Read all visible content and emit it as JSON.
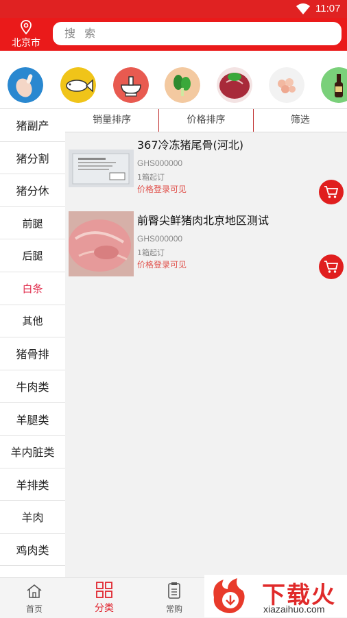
{
  "status_bar": {
    "time": "11:07"
  },
  "header": {
    "city": "北京市",
    "search_placeholder": "搜 索"
  },
  "categories": [
    {
      "icon": "chicken-leg-icon",
      "color": "#2a88d0"
    },
    {
      "icon": "fish-icon",
      "color": "#f0c419"
    },
    {
      "icon": "hotpot-icon",
      "color": "#e85a50"
    },
    {
      "icon": "vegetable-icon",
      "color": "#f3c9a0"
    },
    {
      "icon": "beef-icon",
      "color": "#b23040"
    },
    {
      "icon": "shrimp-icon",
      "color": "#e0e0e0"
    },
    {
      "icon": "sauce-bottle-icon",
      "color": "#7ad07a"
    }
  ],
  "sidebar": {
    "active_index": 5,
    "items": [
      "猪副产",
      "猪分割",
      "猪分休",
      "前腿",
      "后腿",
      "白条",
      "其他",
      "猪骨排",
      "牛肉类",
      "羊腿类",
      "羊内脏类",
      "羊排类",
      "羊肉",
      "鸡肉类"
    ]
  },
  "sort_bar": {
    "options": [
      "销量排序",
      "价格排序",
      "筛选"
    ]
  },
  "products": [
    {
      "name": "367冷冻猪尾骨(河北)",
      "code": "GHS000000",
      "moq": "1箱起订",
      "price": "价格登录可见"
    },
    {
      "name": "前臀尖鲜猪肉北京地区测试",
      "code": "GHS000000",
      "moq": "1箱起订",
      "price": "价格登录可见"
    }
  ],
  "tab_bar": {
    "active": "tab-category",
    "tabs": [
      {
        "label": "首页",
        "icon": "home-icon"
      },
      {
        "label": "分类",
        "icon": "grid-icon"
      },
      {
        "label": "常购",
        "icon": "clipboard-icon"
      }
    ]
  },
  "watermark": {
    "title": "下载火",
    "site": "xiazaihuo.com"
  },
  "colors": {
    "brand_red": "#e02222",
    "accent_pink": "#e02a4a",
    "price_red": "#e0504a"
  }
}
